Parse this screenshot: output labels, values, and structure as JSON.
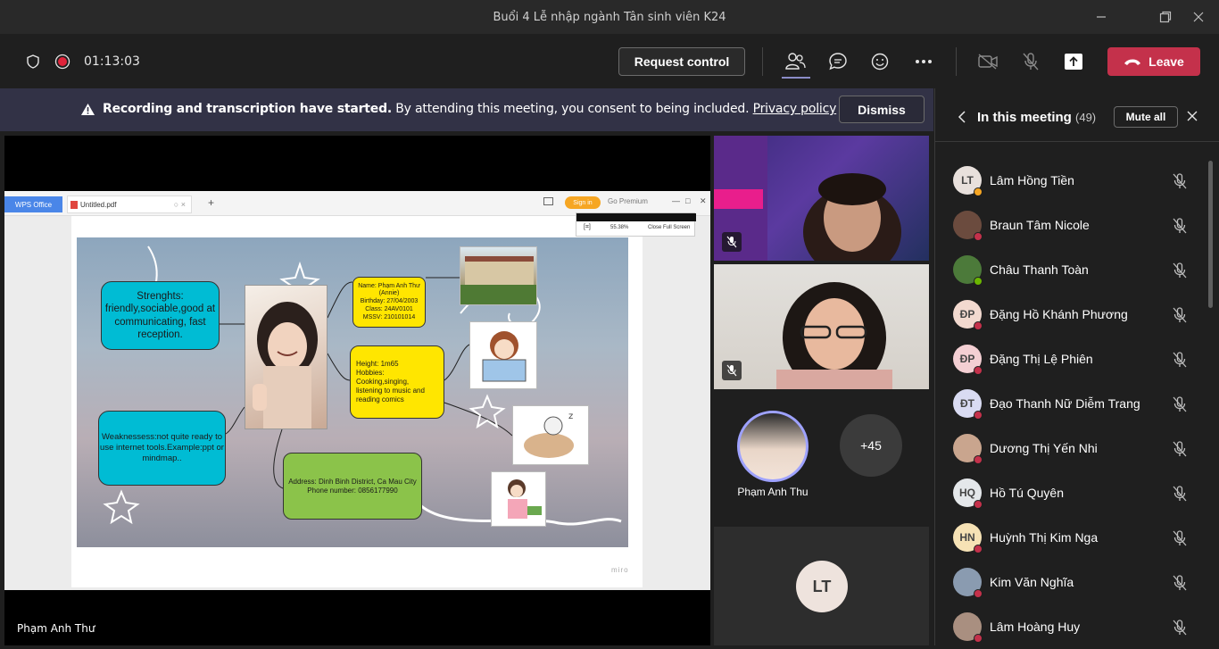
{
  "window": {
    "title": "Buổi 4 Lễ nhập ngành Tân sinh viên K24"
  },
  "toolbar": {
    "timer": "01:13:03",
    "request_control": "Request control",
    "leave": "Leave"
  },
  "banner": {
    "bold": "Recording and transcription have started.",
    "text": " By attending this meeting, you consent to being included. ",
    "link": "Privacy policy",
    "dismiss": "Dismiss"
  },
  "stage": {
    "presenter": "Phạm Anh Thư",
    "wps": {
      "app": "WPS Office",
      "tab": "Untitled.pdf",
      "sign_in": "Sign in",
      "premium": "Go Premium",
      "zoom": "55.38%",
      "close_fullscreen": "Close Full Screen",
      "watermark": "miro"
    },
    "mindmap": {
      "strengths": "Strenghts: friendly,sociable,good at communicating, fast reception.",
      "weaknesses": "Weaknessess:not quite ready to use internet tools.Example:ppt or mindmap..",
      "name_lines": [
        "Name: Phạm Anh Thư",
        "(Annie)",
        "Birthday: 27/04/2003",
        "Class: 24AV0101",
        "MSSV: 210101014"
      ],
      "hobby_lines": [
        "Height: 1m65",
        "Hobbies: Cooking,singing,",
        "listening to music and",
        "reading comics"
      ],
      "address_lines": [
        "Address: Dinh Binh District, Ca Mau City",
        "Phone number: 0856177990"
      ]
    }
  },
  "gallery": {
    "avatar_name": "Phạm Anh Thu",
    "more": "+45",
    "lt_initials": "LT"
  },
  "panel": {
    "title": "In this meeting",
    "count": "(49)",
    "mute_all": "Mute all",
    "participants": [
      {
        "name": "Lâm Hồng Tiền",
        "initials": "LT",
        "avatar_bg": "#e8e0dc",
        "status": "#f6a623"
      },
      {
        "name": "Braun Tâm Nicole",
        "initials": "",
        "avatar_bg": "#6b4b3e",
        "status": "#c4314b"
      },
      {
        "name": "Châu Thanh Toàn",
        "initials": "",
        "avatar_bg": "#4c7a3a",
        "status": "#6bb700"
      },
      {
        "name": "Đặng Hồ Khánh Phương",
        "initials": "ĐP",
        "avatar_bg": "#f2d9cf",
        "status": "#c4314b"
      },
      {
        "name": "Đặng Thị Lệ Phiên",
        "initials": "ĐP",
        "avatar_bg": "#f4cfd3",
        "status": "#c4314b"
      },
      {
        "name": "Đạo Thanh Nữ Diễm Trang",
        "initials": "ĐT",
        "avatar_bg": "#d9dbf2",
        "status": "#c4314b"
      },
      {
        "name": "Dương Thị Yến Nhi",
        "initials": "",
        "avatar_bg": "#c9a58e",
        "status": "#c4314b"
      },
      {
        "name": "Hồ Tú Quyên",
        "initials": "HQ",
        "avatar_bg": "#e4e7ea",
        "status": "#c4314b"
      },
      {
        "name": "Huỳnh Thị Kim Nga",
        "initials": "HN",
        "avatar_bg": "#f6e2b5",
        "status": "#c4314b"
      },
      {
        "name": "Kim Văn Nghĩa",
        "initials": "",
        "avatar_bg": "#8a9bb0",
        "status": "#c4314b"
      },
      {
        "name": "Lâm Hoàng Huy",
        "initials": "",
        "avatar_bg": "#a98f80",
        "status": "#c4314b"
      }
    ]
  }
}
